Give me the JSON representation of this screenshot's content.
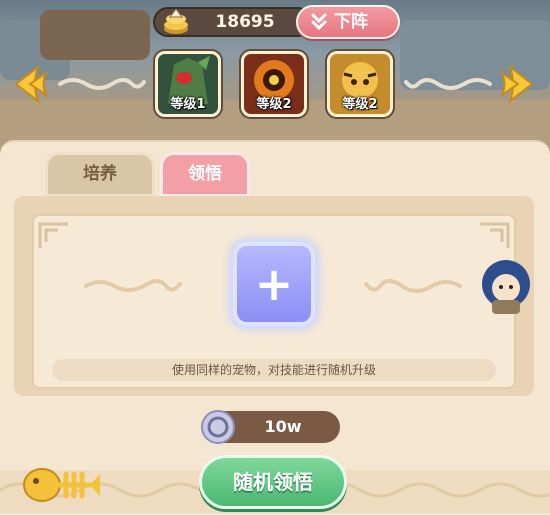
{
  "header": {
    "coins": "18695",
    "unequip_label": "下阵"
  },
  "pets": [
    {
      "icon": "green-dragon-pet-icon",
      "level": "等级1"
    },
    {
      "icon": "fire-beast-pet-icon",
      "level": "等级2"
    },
    {
      "icon": "tiger-warrior-pet-icon",
      "level": "等级2"
    }
  ],
  "tabs": [
    {
      "label": "培养",
      "active": false
    },
    {
      "label": "领悟",
      "active": true
    }
  ],
  "main": {
    "hint": "使用同样的宠物，对技能进行随机升级"
  },
  "cost": {
    "amount": "10w"
  },
  "action": {
    "label": "随机领悟"
  },
  "colors": {
    "accent_pink": "#e67781",
    "accent_green": "#4bb872",
    "slot_purple": "#8c8ef4",
    "panel_bg": "#f4e6d0"
  }
}
